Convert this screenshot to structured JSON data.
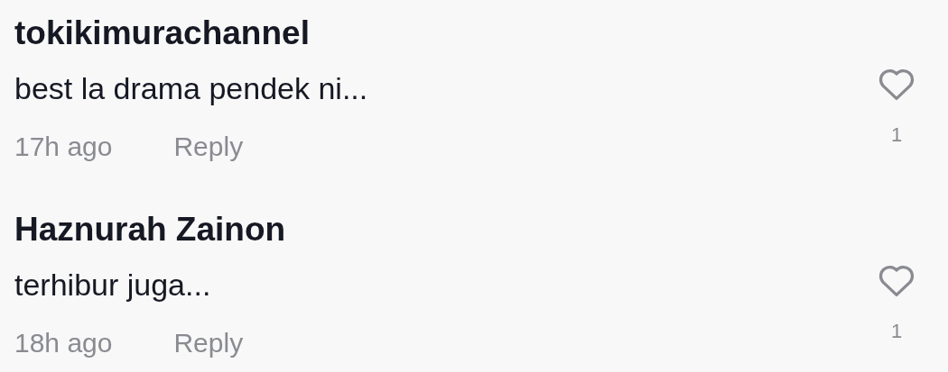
{
  "comments": [
    {
      "username": "tokikimurachannel",
      "text": "best la drama pendek ni...",
      "time": "17h ago",
      "reply": "Reply",
      "liked": false,
      "likes": "1"
    },
    {
      "username": "Haznurah Zainon",
      "text": "terhibur juga...",
      "time": "18h ago",
      "reply": "Reply",
      "liked": false,
      "likes": "1"
    }
  ]
}
